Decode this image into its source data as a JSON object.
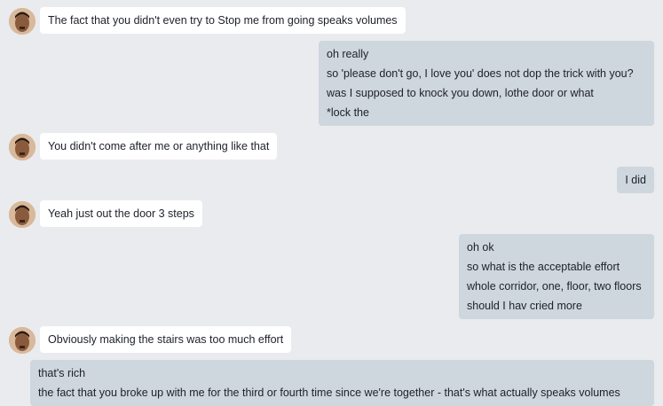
{
  "messages": [
    {
      "sender": "them",
      "lines": [
        "The fact that you didn't even try to Stop me from going speaks volumes"
      ]
    },
    {
      "sender": "me",
      "lines": [
        "oh really",
        "so 'please don't go, I love you' does not dop the trick with you?",
        "was I supposed to knock you down, lothe door or what",
        "*lock the"
      ]
    },
    {
      "sender": "them",
      "lines": [
        "You didn't come after me or anything like that"
      ]
    },
    {
      "sender": "me",
      "lines": [
        "I did"
      ]
    },
    {
      "sender": "them",
      "lines": [
        "Yeah just out the door 3 steps"
      ]
    },
    {
      "sender": "me",
      "lines": [
        "oh ok",
        "so what is the acceptable effort",
        "whole corridor, one, floor, two floors",
        "should I hav cried more"
      ]
    },
    {
      "sender": "them",
      "lines": [
        "Obviously making the stairs was too much effort"
      ]
    },
    {
      "sender": "me",
      "lines": [
        "that's rich",
        "the fact that you broke up with me for the third or fourth time since we're together - that's what actually speaks volumes"
      ]
    }
  ],
  "colors": {
    "background": "#e9ebee",
    "incoming_bubble": "#ffffff",
    "outgoing_bubble": "#ced6de",
    "text": "#1d2129"
  },
  "icons": {
    "avatar": "contact-avatar-photo"
  }
}
